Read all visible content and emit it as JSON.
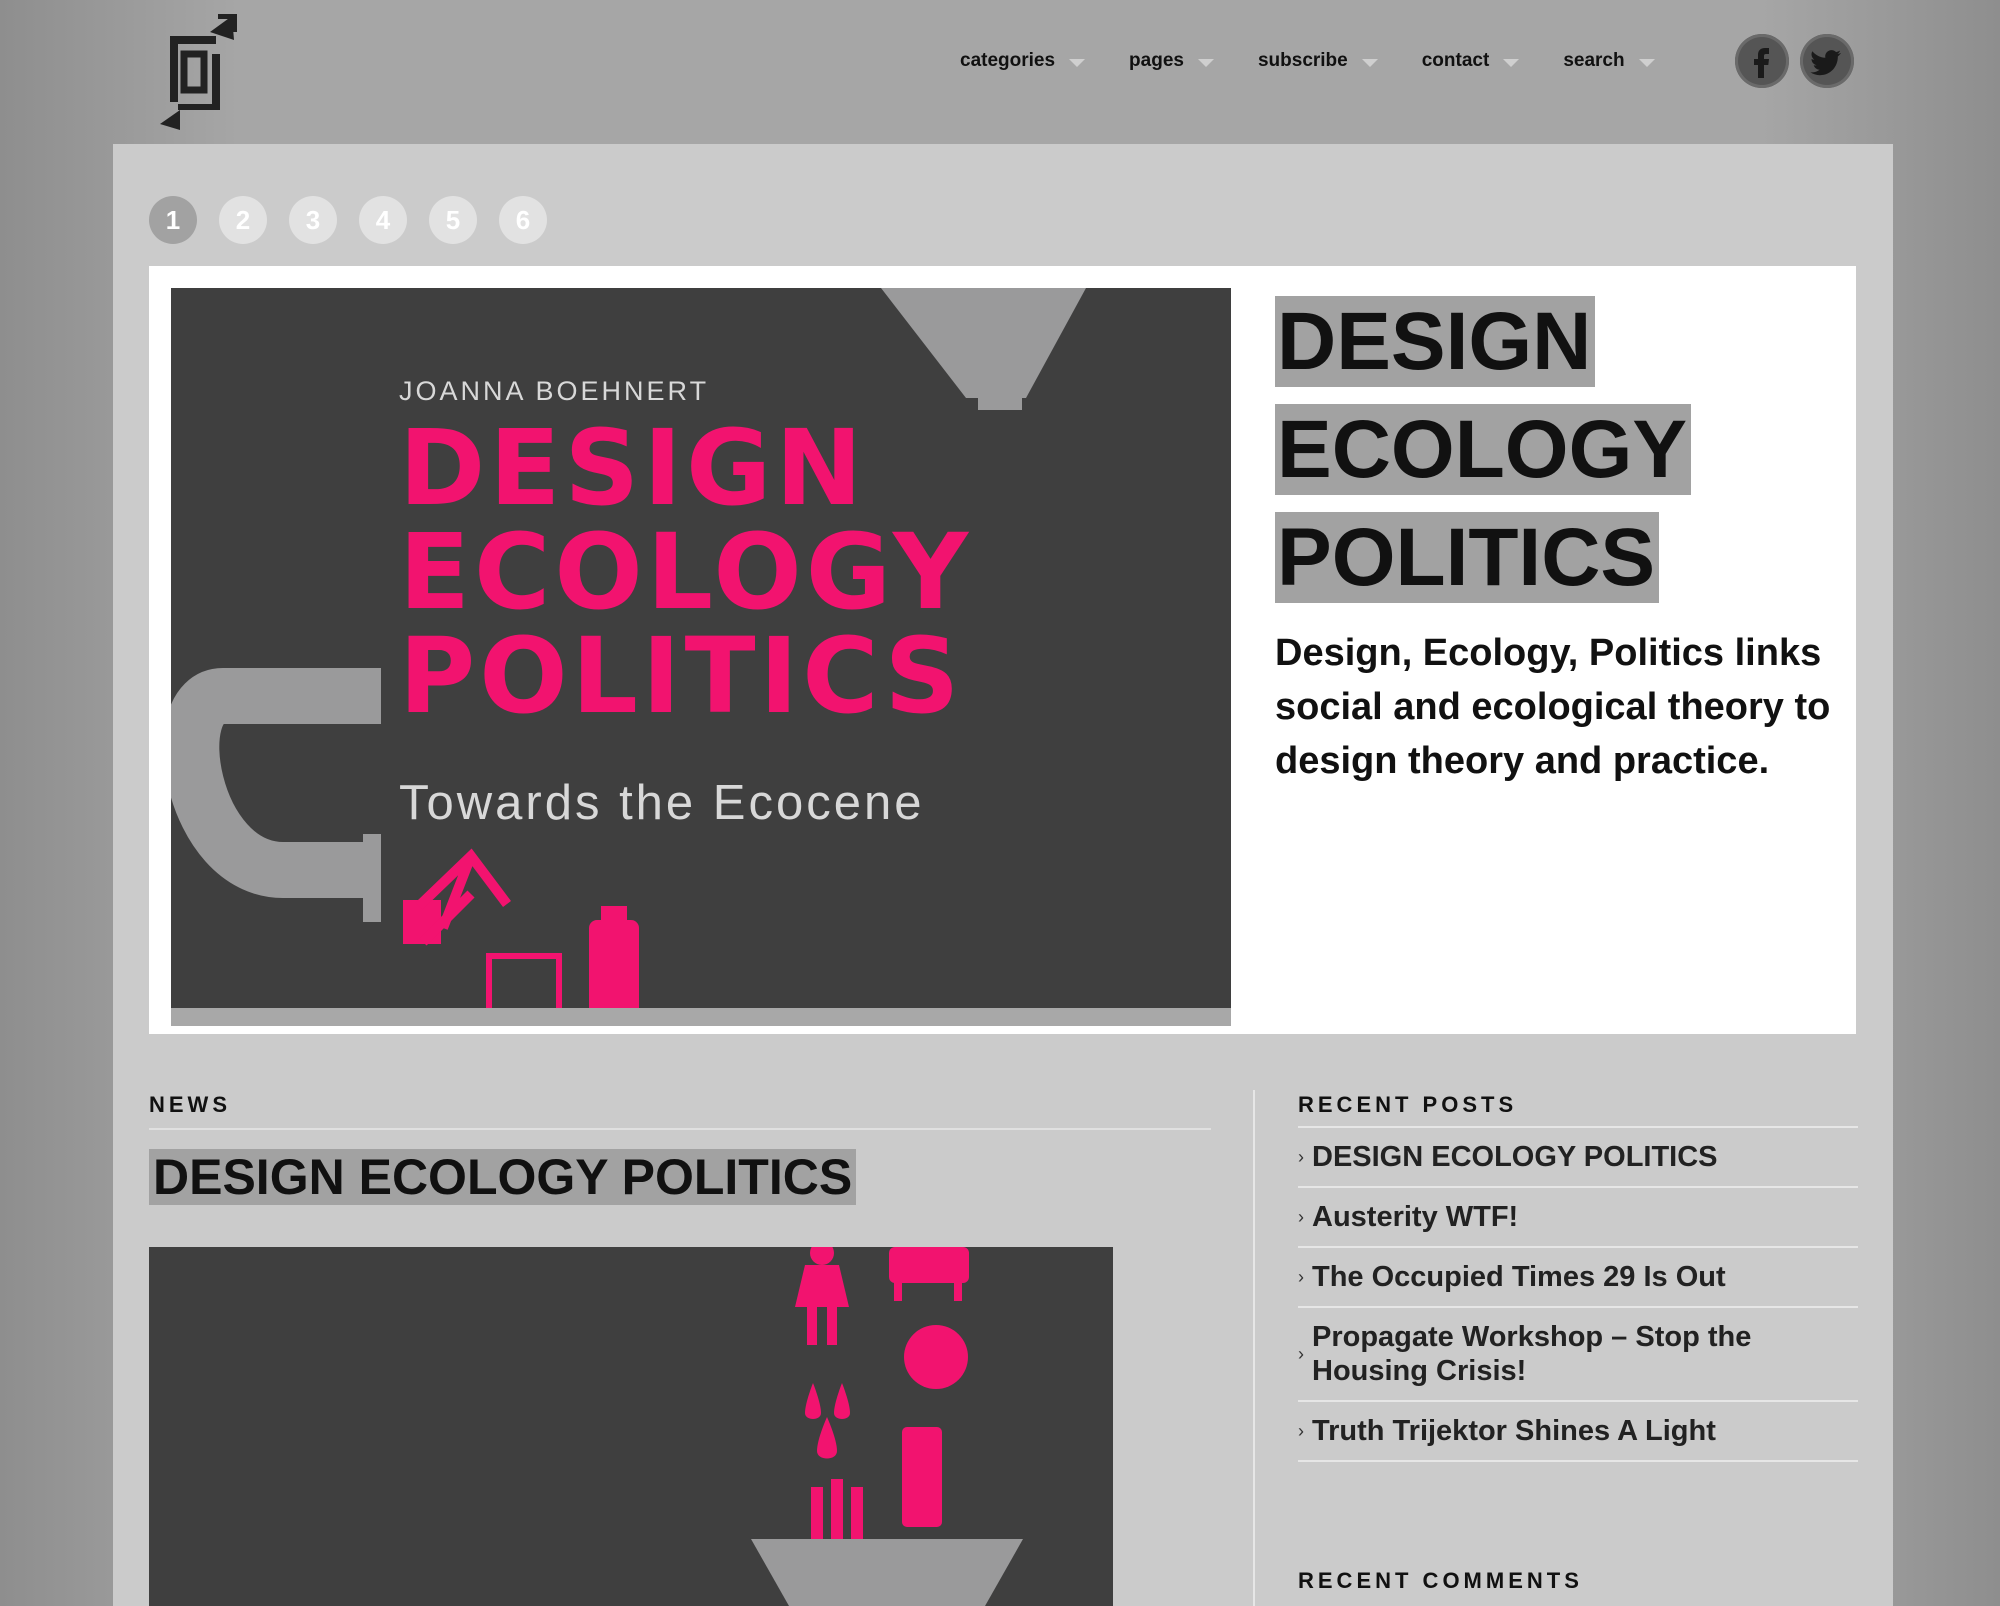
{
  "nav": {
    "items": [
      {
        "label": "categories"
      },
      {
        "label": "pages"
      },
      {
        "label": "subscribe"
      },
      {
        "label": "contact"
      },
      {
        "label": "search"
      }
    ],
    "social": [
      "facebook-icon",
      "twitter-icon"
    ]
  },
  "slider": {
    "pages": [
      "1",
      "2",
      "3",
      "4",
      "5",
      "6"
    ],
    "active_page": "1",
    "cover": {
      "author": "JOANNA BOEHNERT",
      "title_lines": [
        "DESIGN",
        "ECOLOGY",
        "POLITICS"
      ],
      "subtitle": "Towards the Ecocene"
    },
    "title_lines": [
      "DESIGN",
      "ECOLOGY",
      "POLITICS"
    ],
    "excerpt": "Design, Ecology, Politics links social and ecological theory to design theory and practice."
  },
  "news": {
    "heading": "NEWS",
    "post_title": "DESIGN ECOLOGY POLITICS"
  },
  "sidebar": {
    "recent_posts_heading": "RECENT POSTS",
    "recent_posts": [
      "DESIGN ECOLOGY POLITICS",
      "Austerity WTF!",
      "The Occupied Times 29 Is Out",
      "Propagate Workshop – Stop the Housing Crisis!",
      "Truth Trijektor Shines A Light"
    ],
    "recent_comments_heading": "RECENT COMMENTS"
  },
  "colors": {
    "accent_pink": "#f2136f",
    "header_bg": "#a6a6a6",
    "content_bg": "#cbcbcb",
    "highlight": "#a2a2a2"
  }
}
